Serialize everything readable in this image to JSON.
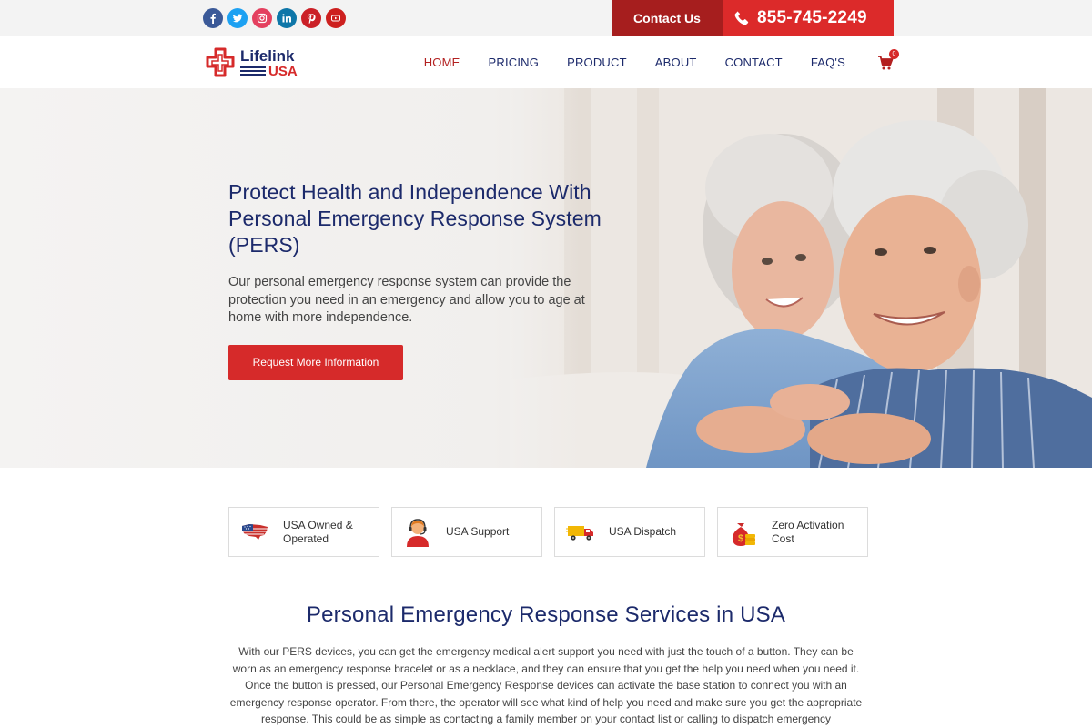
{
  "topbar": {
    "social_icons": [
      "facebook-icon",
      "twitter-icon",
      "instagram-icon",
      "linkedin-icon",
      "pinterest-icon",
      "youtube-icon"
    ],
    "contact_label": "Contact Us",
    "phone": "855-745-2249",
    "colors": {
      "contact_bg": "#a61e1e",
      "phone_bg": "#dc2a2a"
    }
  },
  "nav": {
    "logo_line1": "Lifelink",
    "logo_line2": "USA",
    "items": [
      {
        "label": "HOME"
      },
      {
        "label": "PRICING"
      },
      {
        "label": "PRODUCT"
      },
      {
        "label": "ABOUT"
      },
      {
        "label": "CONTACT"
      },
      {
        "label": "FAQ'S"
      }
    ],
    "active": "HOME",
    "cart_count": "0"
  },
  "hero": {
    "title": "Protect Health and Independence With Personal Emergency Response System (PERS)",
    "description": "Our personal emergency response system can provide the protection you need in an emergency and allow you to age at home with more independence.",
    "button_label": "Request More Information"
  },
  "features": [
    {
      "icon": "usa-map-flag-icon",
      "label": "USA Owned & Operated"
    },
    {
      "icon": "support-agent-icon",
      "label": "USA Support"
    },
    {
      "icon": "delivery-truck-icon",
      "label": "USA Dispatch"
    },
    {
      "icon": "money-bag-icon",
      "label": "Zero Activation Cost"
    }
  ],
  "section": {
    "title": "Personal Emergency Response Services in USA",
    "text": "With our PERS devices, you can get the emergency medical alert support you need with just the touch of a button. They can be worn as an emergency response bracelet or as a necklace, and they can ensure that you get the help you need when you need it. Once the button is pressed, our Personal Emergency Response devices can activate the base station to connect you with an emergency response operator. From there, the operator will see what kind of help you need and make sure you get the appropriate response. This could be as simple as contacting a family member on your contact list or calling to dispatch emergency"
  },
  "colors": {
    "brand_navy": "#1c2a6b",
    "brand_red": "#d62a2a"
  }
}
